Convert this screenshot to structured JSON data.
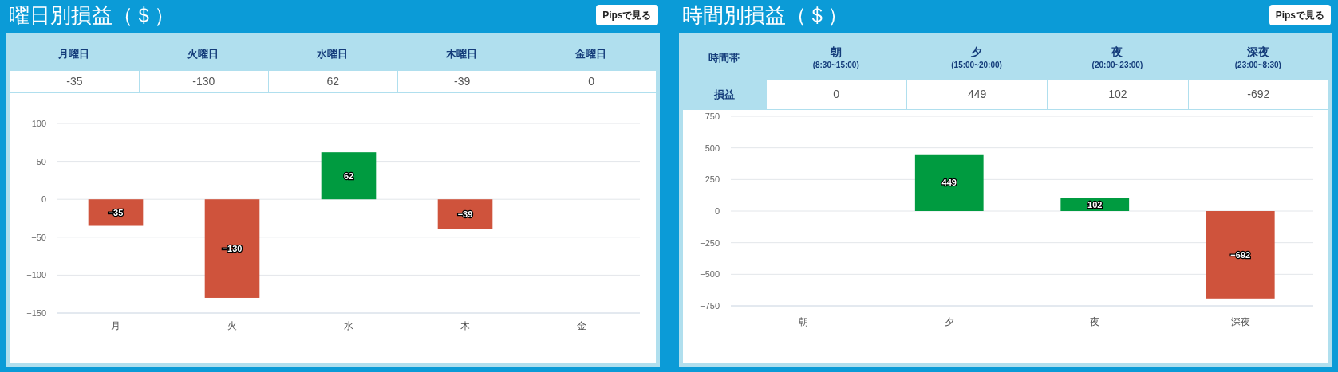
{
  "panels": [
    {
      "title": "曜日別損益（＄）",
      "button": "Pipsで見る",
      "table": {
        "columns": [
          {
            "label": "月曜日"
          },
          {
            "label": "火曜日"
          },
          {
            "label": "水曜日"
          },
          {
            "label": "木曜日"
          },
          {
            "label": "金曜日"
          }
        ],
        "rows": [
          {
            "cells": [
              "-35",
              "-130",
              "62",
              "-39",
              "0"
            ]
          }
        ]
      },
      "chart_data": {
        "type": "bar",
        "categories": [
          "月",
          "火",
          "水",
          "木",
          "金"
        ],
        "values": [
          -35,
          -130,
          62,
          -39,
          0
        ],
        "ylim": [
          -150,
          100
        ],
        "yticks": [
          {
            "value": 100,
            "label": "100"
          },
          {
            "value": 50,
            "label": "50"
          },
          {
            "value": 0,
            "label": "0"
          },
          {
            "value": -50,
            "label": "−50"
          },
          {
            "value": -100,
            "label": "−100"
          },
          {
            "value": -150,
            "label": "−150"
          }
        ],
        "value_labels": [
          "−35",
          "−130",
          "62",
          "−39",
          null
        ],
        "grid": true
      }
    },
    {
      "title": "時間別損益（＄）",
      "button": "Pipsで見る",
      "table": {
        "corner": "時間帯",
        "columns": [
          {
            "label": "朝",
            "sub": "(8:30~15:00)"
          },
          {
            "label": "夕",
            "sub": "(15:00~20:00)"
          },
          {
            "label": "夜",
            "sub": "(20:00~23:00)"
          },
          {
            "label": "深夜",
            "sub": "(23:00~8:30)"
          }
        ],
        "rows": [
          {
            "header": "損益",
            "cells": [
              "0",
              "449",
              "102",
              "-692"
            ]
          }
        ]
      },
      "chart_data": {
        "type": "bar",
        "categories": [
          "朝",
          "夕",
          "夜",
          "深夜"
        ],
        "values": [
          0,
          449,
          102,
          -692
        ],
        "ylim": [
          -750,
          750
        ],
        "yticks": [
          {
            "value": 750,
            "label": "750"
          },
          {
            "value": 500,
            "label": "500"
          },
          {
            "value": 250,
            "label": "250"
          },
          {
            "value": 0,
            "label": "0"
          },
          {
            "value": -250,
            "label": "−250"
          },
          {
            "value": -500,
            "label": "−500"
          },
          {
            "value": -750,
            "label": "−750"
          }
        ],
        "value_labels": [
          null,
          "449",
          "102",
          "−692"
        ],
        "grid": true
      }
    }
  ]
}
